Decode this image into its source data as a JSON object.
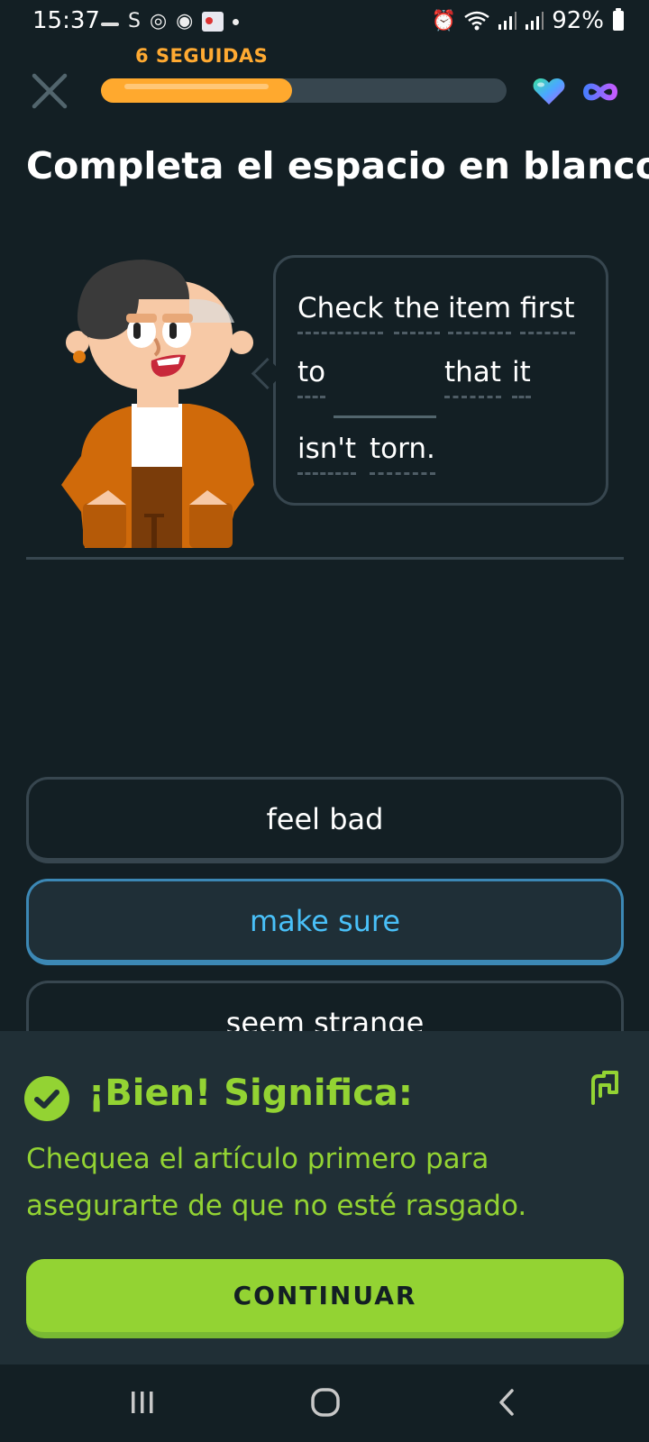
{
  "status_bar": {
    "time": "15:37",
    "battery": "92%"
  },
  "header": {
    "streak_label": "6 SEGUIDAS",
    "progress": 0.47
  },
  "title": "Completa el espacio en blanco",
  "sentence": {
    "line1": [
      "Check",
      "the",
      "item",
      "first"
    ],
    "line2": [
      "to",
      "that",
      "it"
    ],
    "line3": [
      "isn't",
      "torn."
    ]
  },
  "options": [
    "feel bad",
    "make sure",
    "seem strange"
  ],
  "selected_option": "make sure",
  "feedback": {
    "title": "¡Bien! Significa:",
    "translation": "Chequea el artículo primero para asegurarte de que no esté rasgado.",
    "continue_label": "CONTINUAR"
  },
  "colors": {
    "background": "#131f24",
    "border": "#37464f",
    "streak_orange": "#ffaa32",
    "correct_green": "#93d333",
    "selected_blue": "#49c0f8",
    "feedback_bg": "#202f36"
  },
  "icons": {
    "close": "close-icon",
    "heart": "heart-icon",
    "infinity": "infinity-icon",
    "check": "check-icon",
    "flag": "flag-icon"
  }
}
